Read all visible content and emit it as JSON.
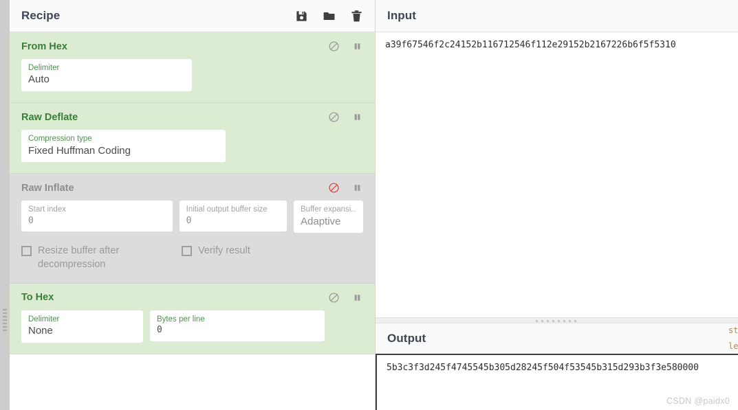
{
  "recipe": {
    "title": "Recipe",
    "toolbar": [
      {
        "name": "save-icon",
        "label": "Save recipe"
      },
      {
        "name": "folder-icon",
        "label": "Load recipe"
      },
      {
        "name": "trash-icon",
        "label": "Clear recipe"
      }
    ],
    "operations": [
      {
        "title": "From Hex",
        "disabled": false,
        "args": [
          {
            "label": "Delimiter",
            "value": "Auto",
            "mono": false
          }
        ],
        "checkboxes": []
      },
      {
        "title": "Raw Deflate",
        "disabled": false,
        "args": [
          {
            "label": "Compression type",
            "value": "Fixed Huffman Coding",
            "mono": false
          }
        ],
        "checkboxes": []
      },
      {
        "title": "Raw Inflate",
        "disabled": true,
        "args": [
          {
            "label": "Start index",
            "value": "0",
            "mono": true
          },
          {
            "label": "Initial output buffer size",
            "value": "0",
            "mono": true
          },
          {
            "label": "Buffer expansi...",
            "value": "Adaptive",
            "mono": false
          }
        ],
        "checkboxes": [
          {
            "label": "Resize buffer after decompression",
            "checked": false
          },
          {
            "label": "Verify result",
            "checked": false
          }
        ]
      },
      {
        "title": "To Hex",
        "disabled": false,
        "args": [
          {
            "label": "Delimiter",
            "value": "None",
            "mono": false
          },
          {
            "label": "Bytes per line",
            "value": "0",
            "mono": true
          }
        ],
        "checkboxes": []
      }
    ]
  },
  "input": {
    "title": "Input",
    "value": "a39f67546f2c24152b116712546f112e29152b2167226b6f5f5310"
  },
  "output": {
    "title": "Output",
    "value": "5b3c3f3d245f4745545b305d28245f504f53545b315d293b3f3e580000",
    "status_clipped": "st",
    "length_clipped": "len"
  },
  "watermark": "CSDN @paidx0",
  "colors": {
    "op_enabled_bg": "#dcecd3",
    "op_disabled_bg": "#dcdcdc",
    "op_title_green": "#3a7c3a",
    "disable_icon_red": "#e8413a"
  }
}
